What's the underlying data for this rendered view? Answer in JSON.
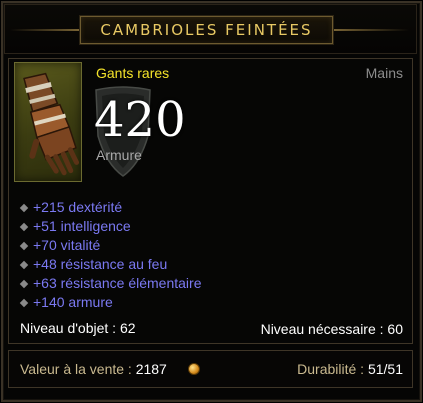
{
  "item": {
    "name": "CAMBRIOLES FEINTÉES",
    "type": "Gants rares",
    "slot": "Mains",
    "armor_value": "420",
    "armor_label": "Armure"
  },
  "affixes": [
    "+215 dextérité",
    "+51 intelligence",
    "+70 vitalité",
    "+48 résistance au feu",
    "+63 résistance élémentaire",
    "+140 armure"
  ],
  "levels": {
    "item_level": "Niveau d'objet : 62",
    "required_level": "Niveau nécessaire : 60"
  },
  "footer": {
    "sell_label": "Valeur à la vente : ",
    "sell_value": "2187",
    "durability_label": "Durabilité : ",
    "durability_value": "51/51"
  },
  "colors": {
    "title": "#e8c964",
    "rare": "#f5e42a",
    "magic_affix": "#7b79f2",
    "label_gold": "#c9b98f"
  },
  "icons": [
    "glove-icon",
    "shield-icon",
    "gold-coin-icon",
    "diamond-bullet-icon"
  ]
}
